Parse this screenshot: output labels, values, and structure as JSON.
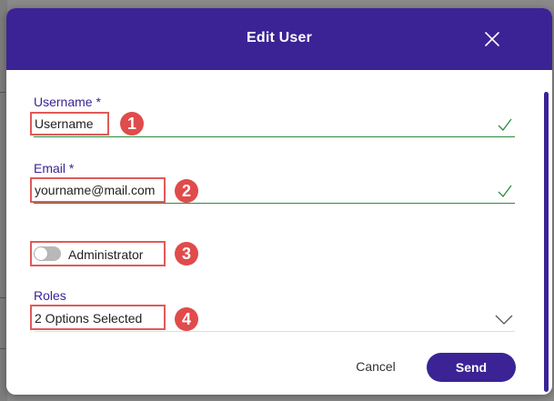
{
  "dialog": {
    "title": "Edit User",
    "close_icon": "close-icon"
  },
  "fields": {
    "username": {
      "label": "Username *",
      "value": "Username"
    },
    "email": {
      "label": "Email *",
      "value": "yourname@mail.com"
    },
    "administrator": {
      "label": "Administrator",
      "enabled": false
    },
    "roles": {
      "label": "Roles",
      "value": "2 Options Selected"
    }
  },
  "annotations": [
    "1",
    "2",
    "3",
    "4"
  ],
  "actions": {
    "cancel": "Cancel",
    "send": "Send"
  },
  "colors": {
    "header": "#3b2395",
    "accent": "#3b2395",
    "valid_underline": "#2e8b3e",
    "annotation": "#e04b4b"
  }
}
